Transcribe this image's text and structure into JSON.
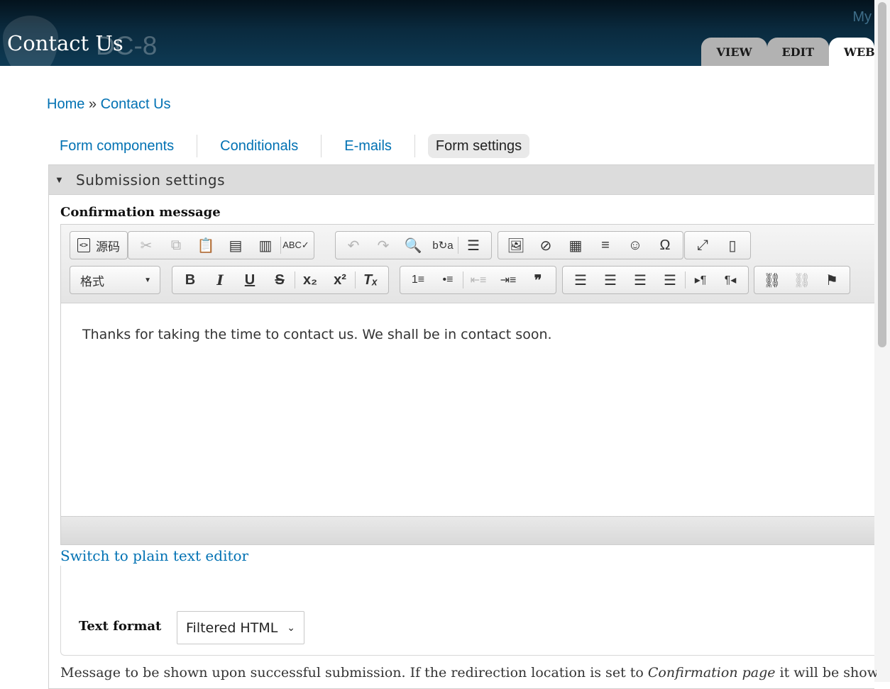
{
  "header": {
    "page_title": "Contact Us",
    "site_ghost": "DC-8",
    "user_link": "My",
    "tabs": [
      {
        "label": "VIEW",
        "active": false
      },
      {
        "label": "EDIT",
        "active": false
      },
      {
        "label": "WEB",
        "active": true
      }
    ]
  },
  "breadcrumb": {
    "home": "Home",
    "separator": "»",
    "current": "Contact Us"
  },
  "secondary_tabs": [
    {
      "label": "Form components",
      "active": false
    },
    {
      "label": "Conditionals",
      "active": false
    },
    {
      "label": "E-mails",
      "active": false
    },
    {
      "label": "Form settings",
      "active": true
    }
  ],
  "fieldset": {
    "legend": "Submission settings",
    "expanded": true
  },
  "confirmation": {
    "label": "Confirmation message",
    "source_button": "源码",
    "format_combo": "格式",
    "body_text": "Thanks for taking the time to contact us. We shall be in contact soon.",
    "switch_link": "Switch to plain text editor"
  },
  "toolbar_icons": {
    "row1": [
      "cut-icon",
      "copy-icon",
      "paste-icon",
      "paste-text-icon",
      "paste-word-icon",
      "spellcheck-icon",
      "undo-icon",
      "redo-icon",
      "find-icon",
      "replace-icon",
      "select-all-icon",
      "image-icon",
      "flash-icon",
      "table-icon",
      "horizontal-rule-icon",
      "smiley-icon",
      "special-char-icon",
      "maximize-icon",
      "show-blocks-icon"
    ],
    "row2": [
      "bold-icon",
      "italic-icon",
      "underline-icon",
      "strike-icon",
      "subscript-icon",
      "superscript-icon",
      "remove-format-icon",
      "numbered-list-icon",
      "bulleted-list-icon",
      "outdent-icon",
      "indent-icon",
      "blockquote-icon",
      "align-left-icon",
      "align-center-icon",
      "align-right-icon",
      "justify-icon",
      "ltr-icon",
      "rtl-icon",
      "link-icon",
      "unlink-icon",
      "anchor-icon"
    ]
  },
  "text_format": {
    "label": "Text format",
    "selected": "Filtered HTML"
  },
  "description": {
    "before": "Message to be shown upon successful submission. If the redirection location is set to ",
    "emphasis": "Confirmation page",
    "after": " it will be shown on"
  },
  "colors": {
    "link": "#0071b3",
    "header_dark": "#04131d",
    "tab_gray": "#b2b2b2"
  }
}
